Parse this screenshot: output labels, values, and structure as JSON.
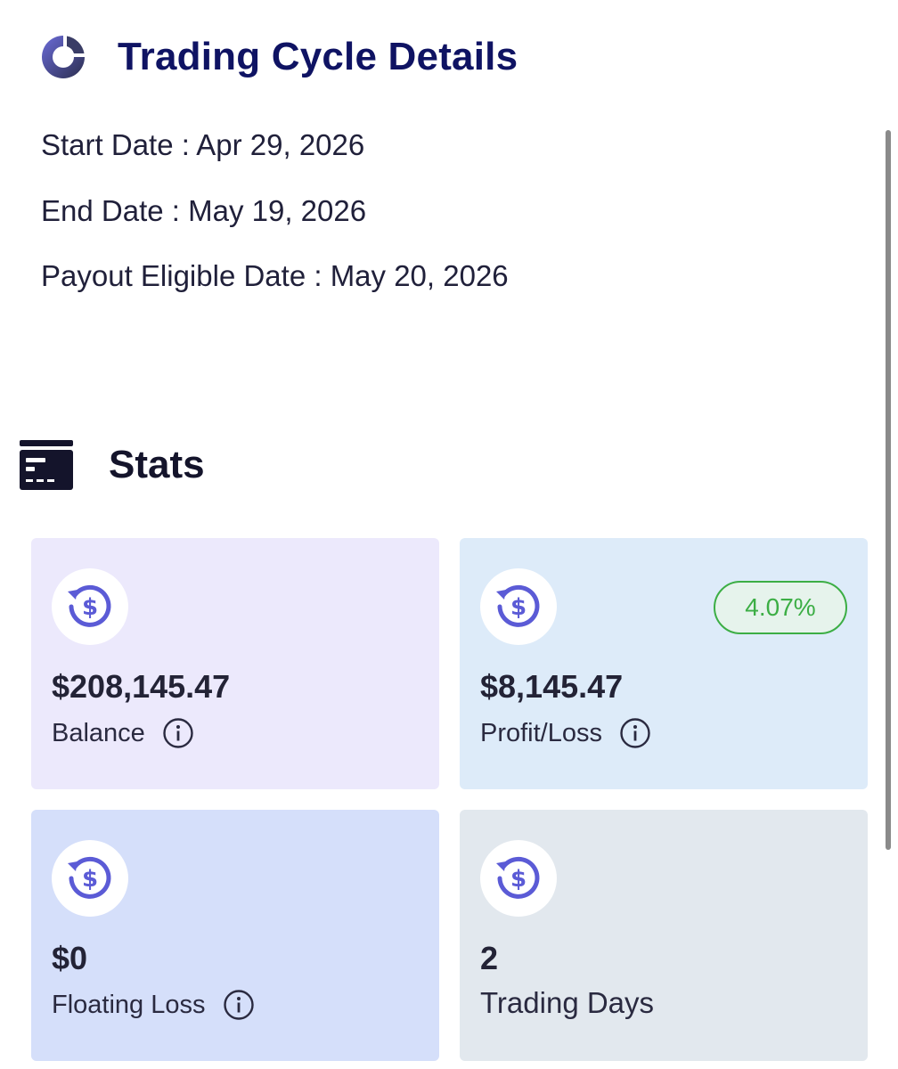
{
  "cycle": {
    "title": "Trading Cycle Details",
    "icon": "cycle-donut-icon",
    "start_label": "Start Date :",
    "start_value": "Apr 29, 2026",
    "end_label": "End Date :",
    "end_value": "May 19, 2026",
    "payout_label": "Payout Eligible Date :",
    "payout_value": "May 20, 2026"
  },
  "stats": {
    "title": "Stats",
    "icon": "card-icon",
    "cards": {
      "balance": {
        "value": "$208,145.47",
        "label": "Balance",
        "icon": "dollar-refresh-icon",
        "info_icon": "info-icon"
      },
      "profit": {
        "value": "$8,145.47",
        "label": "Profit/Loss",
        "badge": "4.07%",
        "icon": "dollar-refresh-icon",
        "info_icon": "info-icon"
      },
      "floating": {
        "value": "$0",
        "label": "Floating Loss",
        "icon": "dollar-refresh-icon",
        "info_icon": "info-icon"
      },
      "days": {
        "value": "2",
        "label": "Trading Days",
        "icon": "dollar-refresh-icon"
      }
    }
  },
  "colors": {
    "title": "#0f1363",
    "accent": "#5b5bd6",
    "badge_green": "#3cae45",
    "balance_bg": "#ece9fc",
    "profit_bg": "#ddebf9",
    "floating_bg": "#d5dffa",
    "days_bg": "#e2e8ee"
  }
}
